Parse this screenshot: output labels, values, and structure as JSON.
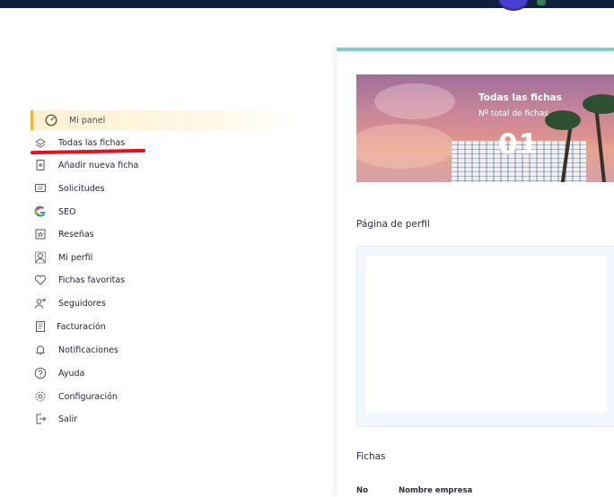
{
  "nav": {
    "items": [
      {
        "label": "Mi panel",
        "icon": "gauge-icon",
        "active": true
      },
      {
        "label": "Todas las fichas",
        "icon": "stack-icon"
      },
      {
        "label": "Añadir nueva ficha",
        "icon": "add-document-icon"
      },
      {
        "label": "Solicitudes",
        "icon": "chat-icon"
      },
      {
        "label": "SEO",
        "icon": "google-icon"
      },
      {
        "label": "Reseñas",
        "icon": "review-icon"
      },
      {
        "label": "Mi perfil",
        "icon": "user-badge-icon"
      },
      {
        "label": "Fichas favoritas",
        "icon": "heart-icon"
      },
      {
        "label": "Seguidores",
        "icon": "add-user-icon"
      },
      {
        "label": "Facturación",
        "icon": "invoice-icon"
      },
      {
        "label": "Notificaciones",
        "icon": "bell-icon"
      },
      {
        "label": "Ayuda",
        "icon": "help-icon"
      },
      {
        "label": "Configuración",
        "icon": "gear-icon"
      },
      {
        "label": "Salir",
        "icon": "logout-icon"
      }
    ]
  },
  "banner": {
    "title": "Todas las fichas",
    "subtitle": "Nº total de fichas",
    "count": "01"
  },
  "profile": {
    "title": "Página de perfil"
  },
  "fichas": {
    "title": "Fichas",
    "columns": [
      "No",
      "Nombre empresa"
    ]
  },
  "colors": {
    "accent_top": "#7fcfc3",
    "active_bar": "#f3b23a",
    "annotation": "#e5111f",
    "topbar": "#0f1f3d"
  }
}
